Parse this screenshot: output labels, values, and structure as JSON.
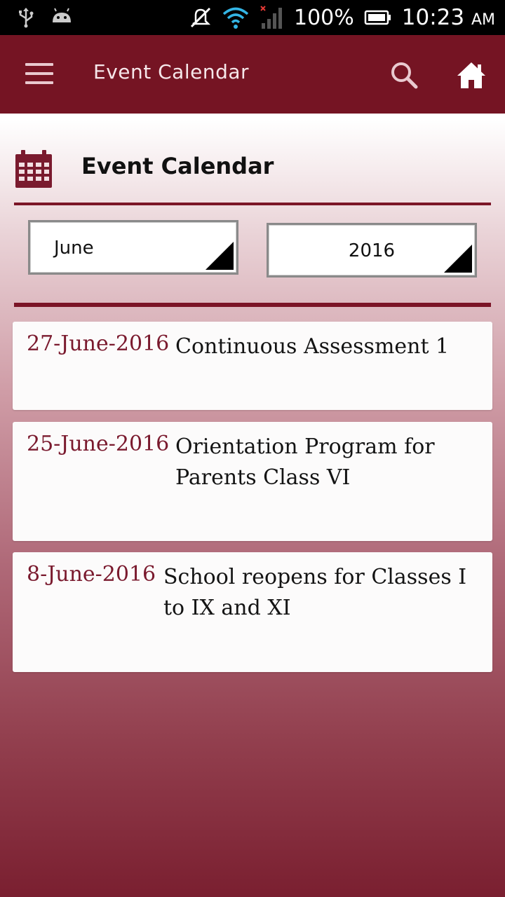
{
  "status_bar": {
    "battery_text": "100%",
    "time": "10:23",
    "ampm": "AM",
    "icons": [
      "usb-icon",
      "android-icon",
      "mute-icon",
      "wifi-icon",
      "signal-icon",
      "battery-icon"
    ]
  },
  "app_bar": {
    "title": "Event Calendar",
    "background": "#751423",
    "icons": [
      "menu-icon",
      "search-icon",
      "home-icon"
    ]
  },
  "header": {
    "title": "Event Calendar",
    "icon": "calendar-icon"
  },
  "filters": {
    "month": "June",
    "year": "2016"
  },
  "events": [
    {
      "date": "27-June-2016",
      "description": "Continuous Assessment 1"
    },
    {
      "date": "25-June-2016",
      "description": "Orientation Program for Parents Class VI"
    },
    {
      "date": "8-June-2016",
      "description": "School reopens for Classes I to IX and XI"
    }
  ],
  "colors": {
    "accent": "#751423",
    "date_text": "#7a1a2e"
  }
}
